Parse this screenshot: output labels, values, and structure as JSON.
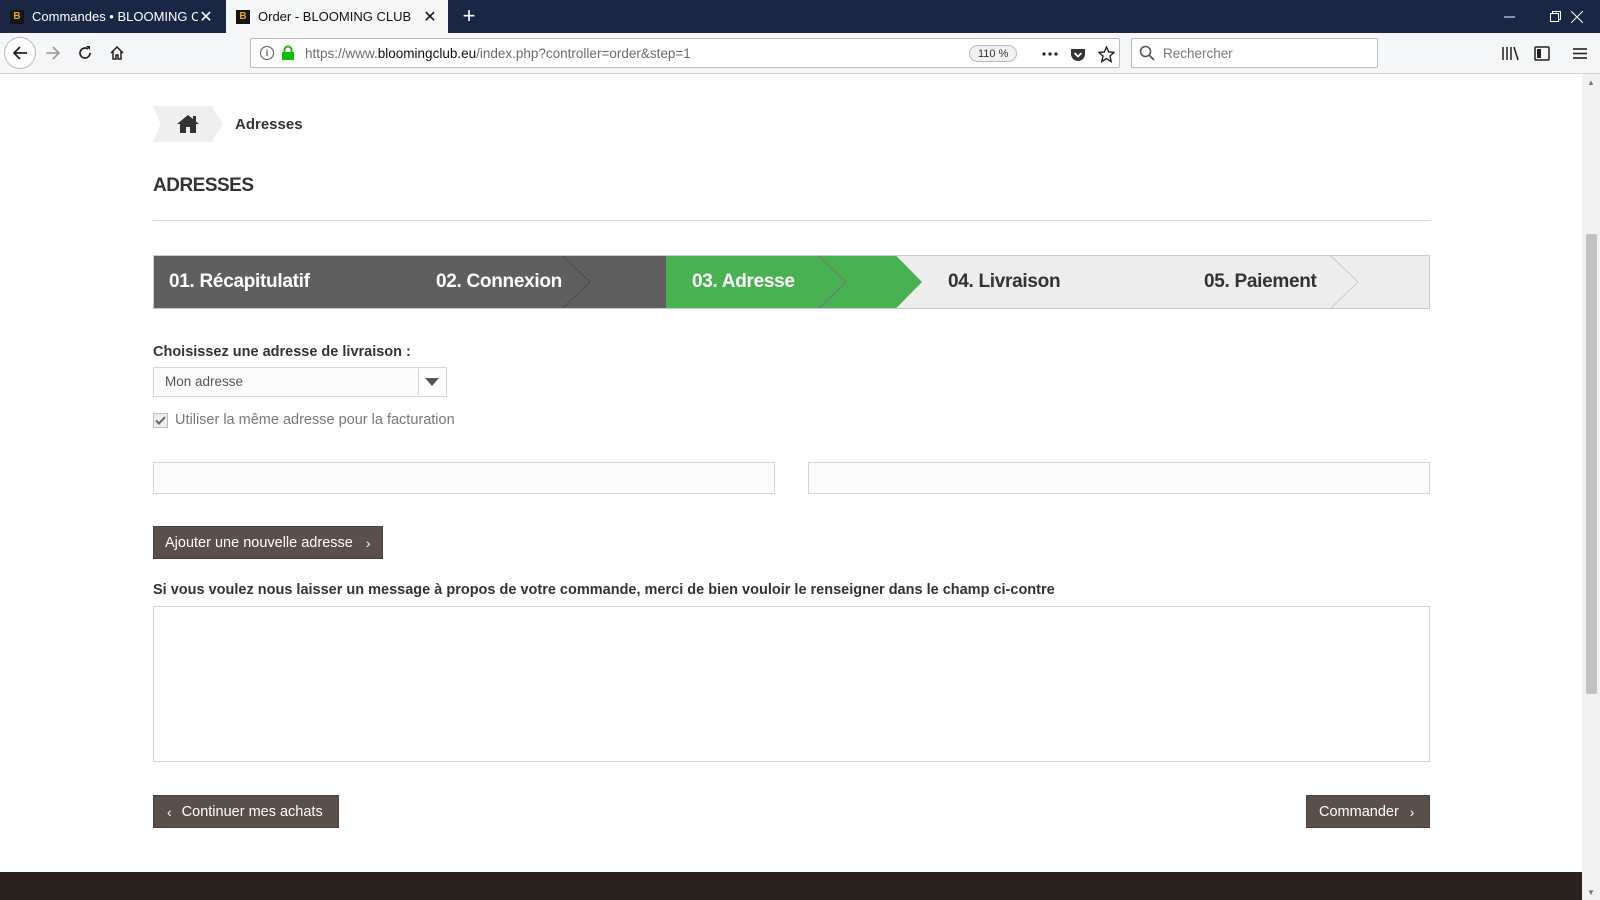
{
  "browser": {
    "tabs": [
      {
        "title": "Commandes • BLOOMING CLUB",
        "active": false
      },
      {
        "title": "Order - BLOOMING CLUB",
        "active": true
      }
    ],
    "favicon_text": "B",
    "url": {
      "prefix": "https://www.",
      "domain": "bloomingclub.eu",
      "path": "/index.php?controller=order&step=1"
    },
    "zoom": "110 %",
    "search_placeholder": "Rechercher",
    "icons": [
      "back-icon",
      "forward-icon",
      "reload-icon",
      "home-icon",
      "info-icon",
      "lock-icon",
      "more-icon",
      "pocket-icon",
      "star-icon",
      "search-icon",
      "library-icon",
      "sidebar-icon",
      "menu-icon"
    ]
  },
  "page": {
    "breadcrumb": {
      "current": "Adresses"
    },
    "heading": "ADRESSES",
    "steps": [
      {
        "num": "01.",
        "label": "Récapitulatif",
        "state": "done"
      },
      {
        "num": "02.",
        "label": "Connexion",
        "state": "done"
      },
      {
        "num": "03.",
        "label": "Adresse",
        "state": "current"
      },
      {
        "num": "04.",
        "label": "Livraison",
        "state": "todo"
      },
      {
        "num": "05.",
        "label": "Paiement",
        "state": "todo"
      }
    ],
    "delivery_label": "Choisissez une adresse de livraison :",
    "delivery_selected": "Mon adresse",
    "same_billing_label": "Utiliser la même adresse pour la facturation",
    "same_billing_checked": true,
    "add_address_label": "Ajouter une nouvelle adresse",
    "message_label": "Si vous voulez nous laisser un message à propos de votre commande, merci de bien vouloir le renseigner dans le champ ci-contre",
    "continue_label": "Continuer mes achats",
    "order_label": "Commander"
  },
  "colors": {
    "tabbar": "#1b2644",
    "step_done": "#5f5f5f",
    "step_current": "#48b151",
    "step_todo": "#ededed",
    "button": "#5b4f4a",
    "footer": "#2a2320"
  }
}
